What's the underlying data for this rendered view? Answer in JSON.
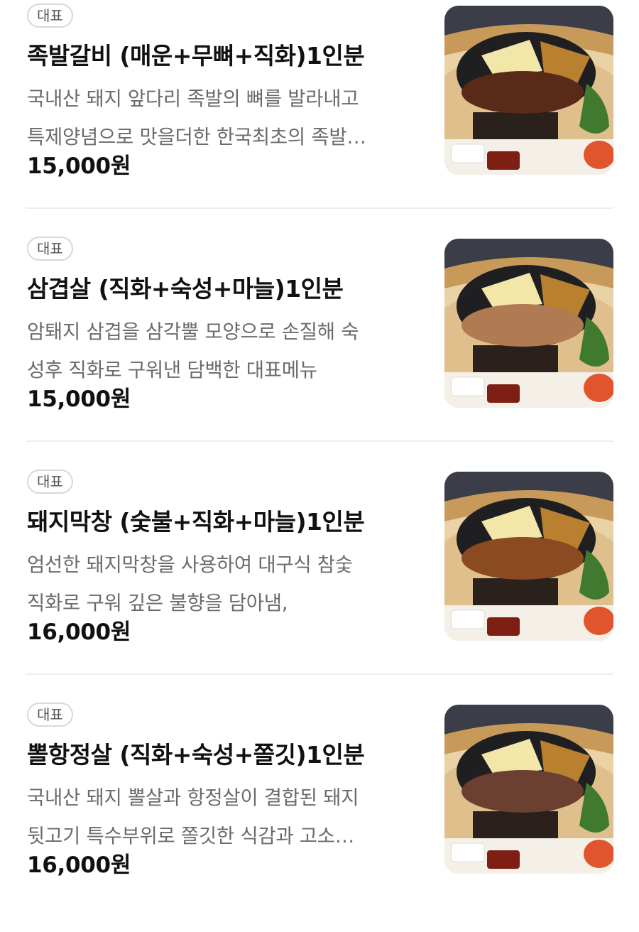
{
  "menu": {
    "items": [
      {
        "badge": "대표",
        "name": "족발갈비 (매운+무뼈+직화)1인분",
        "desc_line1": "국내산 돼지 앞다리 족발의 뼈를 발라내고",
        "desc_line2": "특제양념으로 맛을더한 한국최초의 족발…",
        "price": "15,000원",
        "meat_color": "#5a2a18"
      },
      {
        "badge": "대표",
        "name": "삼겹살 (직화+숙성+마늘)1인분",
        "desc_line1": "암퇘지 삼겹을 삼각뿔 모양으로 손질해 숙",
        "desc_line2": "성후 직화로 구워낸 담백한 대표메뉴",
        "price": "15,000원",
        "meat_color": "#b07a52"
      },
      {
        "badge": "대표",
        "name": "돼지막창 (숯불+직화+마늘)1인분",
        "desc_line1": "엄선한 돼지막창을 사용하여 대구식 참숯",
        "desc_line2": "직화로 구워 깊은 불향을 담아냄,",
        "price": "16,000원",
        "meat_color": "#8a4a22"
      },
      {
        "badge": "대표",
        "name": "뽈항정살 (직화+숙성+쫄깃)1인분",
        "desc_line1": "국내산 돼지 뽈살과 항정살이 결합된 돼지",
        "desc_line2": "뒷고기 특수부위로 쫄깃한 식감과 고소…",
        "price": "16,000원",
        "meat_color": "#6b4030"
      }
    ]
  }
}
